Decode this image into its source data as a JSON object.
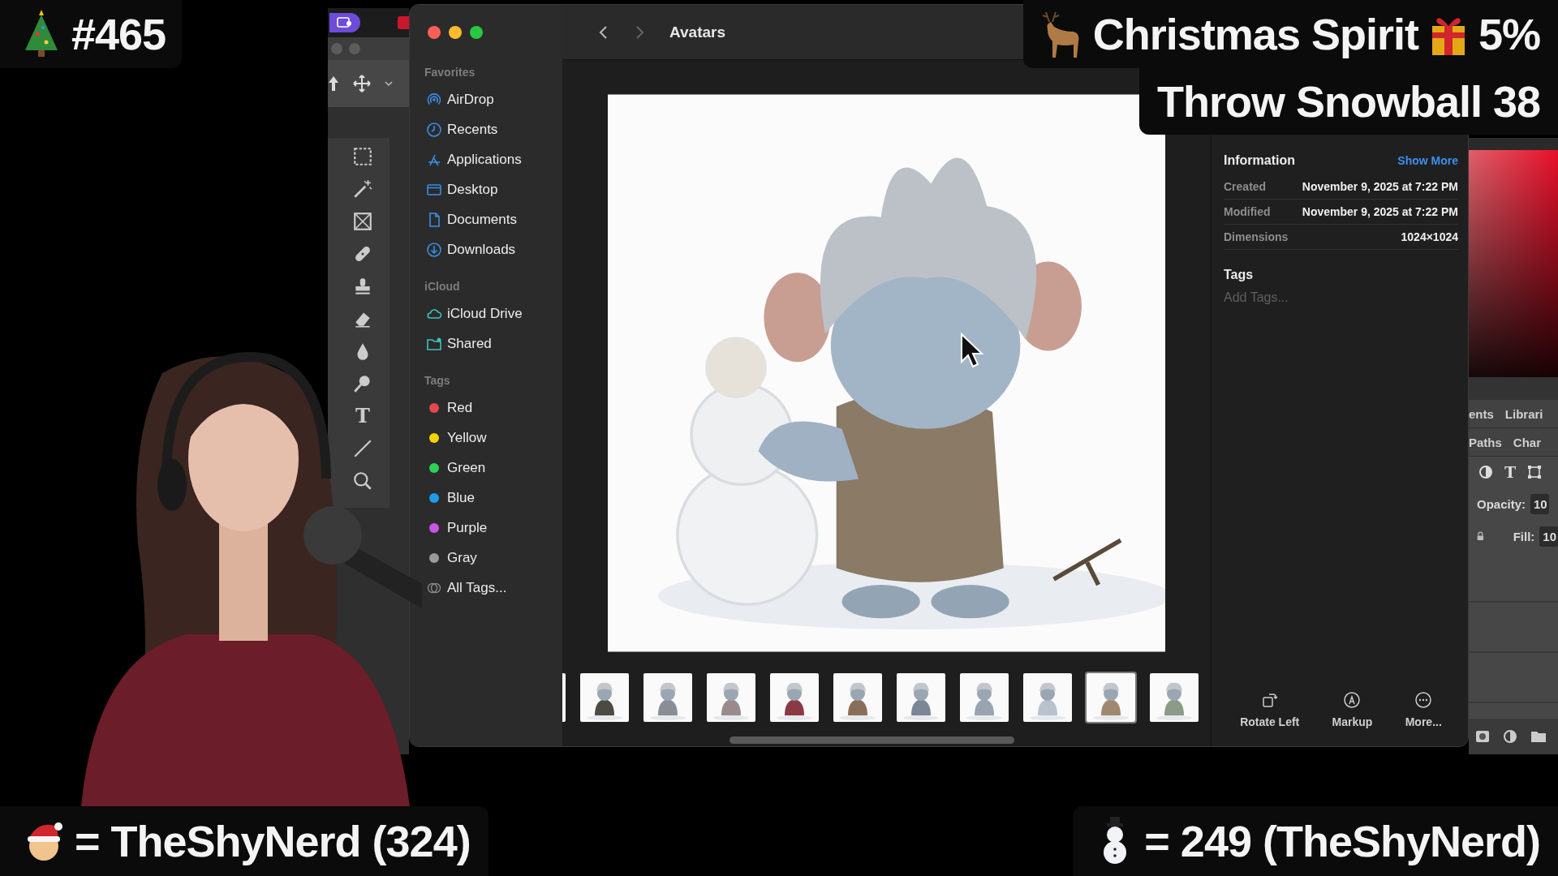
{
  "overlay": {
    "episode": "#465",
    "spirit_label": "Christmas Spirit",
    "spirit_value": "5%",
    "snowball": "Throw Snowball 38",
    "leader_left": "= TheShyNerd (324)",
    "leader_right": "= 249 (TheShyNerd)"
  },
  "photoshop": {
    "tools": [
      {
        "kind": "marquee"
      },
      {
        "kind": "wand"
      },
      {
        "kind": "frame"
      },
      {
        "kind": "healing"
      },
      {
        "kind": "stamp"
      },
      {
        "kind": "eraser"
      },
      {
        "kind": "drop"
      },
      {
        "kind": "dodge"
      },
      {
        "kind": "type",
        "glyph": "T"
      },
      {
        "kind": "line"
      },
      {
        "kind": "zoom"
      }
    ],
    "panel": {
      "tabs": [
        {
          "label": "ents"
        },
        {
          "label": "Librari"
        }
      ],
      "tabs_2": [
        {
          "label": "Paths"
        },
        {
          "label": "Char"
        }
      ],
      "type_glyph": "T",
      "opacity_label": "Opacity:",
      "opacity_value": "10",
      "fill_label": "Fill:",
      "fill_value": "10"
    }
  },
  "finder": {
    "title": "Avatars",
    "sidebar": [
      {
        "title": "Favorites",
        "items": [
          {
            "label": "AirDrop",
            "kind": "airdrop"
          },
          {
            "label": "Recents",
            "kind": "clock"
          },
          {
            "label": "Applications",
            "kind": "apps"
          },
          {
            "label": "Desktop",
            "kind": "desktop"
          },
          {
            "label": "Documents",
            "kind": "document"
          },
          {
            "label": "Downloads",
            "kind": "download"
          }
        ]
      },
      {
        "title": "iCloud",
        "items": [
          {
            "label": "iCloud Drive",
            "kind": "cloud"
          },
          {
            "label": "Shared",
            "kind": "shared"
          }
        ]
      },
      {
        "title": "Tags",
        "items": [
          {
            "label": "Red",
            "kind": "tag",
            "color": "#e5484d"
          },
          {
            "label": "Yellow",
            "kind": "tag",
            "color": "#f2d400"
          },
          {
            "label": "Green",
            "kind": "tag",
            "color": "#2ed158"
          },
          {
            "label": "Blue",
            "kind": "tag",
            "color": "#1e9bf0"
          },
          {
            "label": "Purple",
            "kind": "tag",
            "color": "#c855e8"
          },
          {
            "label": "Gray",
            "kind": "tag",
            "color": "#9a9a9a"
          },
          {
            "label": "All Tags...",
            "kind": "all-tags"
          }
        ]
      }
    ],
    "thumbnails": [
      {
        "kind": "picture",
        "selected": false
      },
      {
        "kind": "picture",
        "selected": false
      },
      {
        "kind": "picture",
        "selected": false
      },
      {
        "kind": "picture",
        "selected": false
      },
      {
        "kind": "picture",
        "selected": false
      },
      {
        "kind": "picture",
        "selected": false
      },
      {
        "kind": "picture",
        "selected": false
      },
      {
        "kind": "picture",
        "selected": false
      },
      {
        "kind": "picture",
        "selected": false
      },
      {
        "kind": "picture",
        "selected": true
      },
      {
        "kind": "picture",
        "selected": false
      }
    ],
    "info": {
      "title": "Information",
      "show_more": "Show More",
      "rows": [
        {
          "label": "Created",
          "value": "November 9, 2025 at 7:22 PM"
        },
        {
          "label": "Modified",
          "value": "November 9, 2025 at 7:22 PM"
        },
        {
          "label": "Dimensions",
          "value": "1024×1024"
        }
      ],
      "tags_title": "Tags",
      "tags_placeholder": "Add Tags..."
    },
    "actions": [
      {
        "label": "Rotate Left",
        "kind": "rotate"
      },
      {
        "label": "Markup",
        "kind": "markup"
      },
      {
        "label": "More...",
        "kind": "more"
      }
    ]
  }
}
